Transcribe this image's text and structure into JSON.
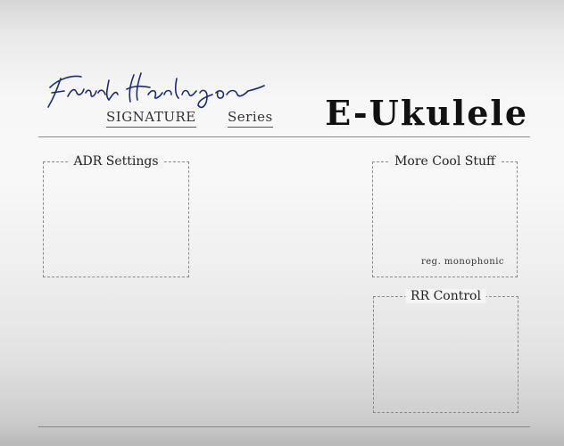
{
  "header": {
    "signature_name": "Frank Heerlingen",
    "signature_word": "SIGNATURE",
    "series_word": "Series",
    "title": "E-Ukulele"
  },
  "panels": {
    "adr": {
      "label": "ADR Settings"
    },
    "more": {
      "label": "More Cool Stuff",
      "mode_text": "reg. monophonic"
    },
    "rr": {
      "label": "RR Control"
    }
  },
  "colors": {
    "signature_ink": "#1a2a7a",
    "divider": "#8a8a8a"
  }
}
